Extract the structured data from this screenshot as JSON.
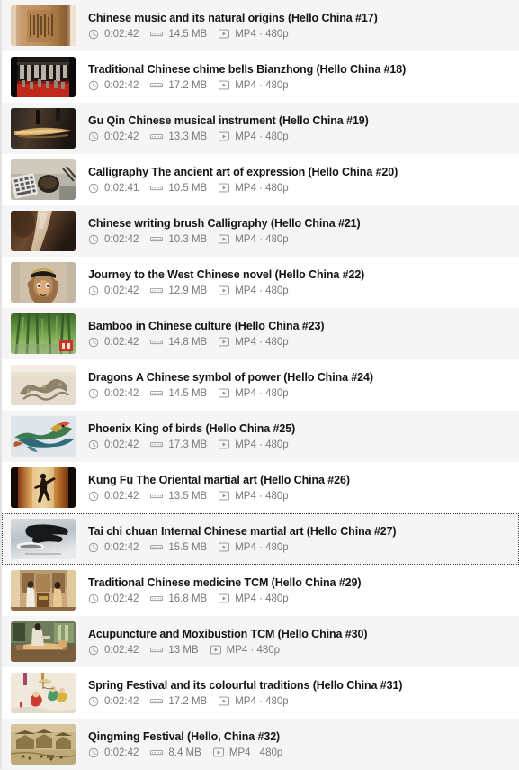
{
  "view": {
    "type": "media-file-list",
    "stripe_color": "#f5f5f5",
    "background_color": "#ffffff",
    "title_color": "#141414",
    "meta_color": "#79797c",
    "focus_outline_color": "#3a3a3a"
  },
  "icons": {
    "duration": "clock-icon",
    "filesize": "storage-icon",
    "format": "play-box-icon"
  },
  "items": [
    {
      "title": "Chinese music and its natural origins (Hello China #17)",
      "duration": "0:02:42",
      "size": "14.5 MB",
      "format": "MP4 · 480p",
      "thumb": "carved-wooden-plaque",
      "focused": false
    },
    {
      "title": "Traditional Chinese chime bells   Bianzhong (Hello China #18)",
      "duration": "0:02:42",
      "size": "17.2 MB",
      "format": "MP4 · 480p",
      "thumb": "chime-bells-red-stage",
      "focused": false
    },
    {
      "title": "Gu Qin   Chinese musical instrument (Hello China #19)",
      "duration": "0:02:42",
      "size": "13.3 MB",
      "format": "MP4 · 480p",
      "thumb": "guqin-zither-dark",
      "focused": false
    },
    {
      "title": "Calligraphy   The ancient art of expression (Hello China #20)",
      "duration": "0:02:41",
      "size": "10.5 MB",
      "format": "MP4 · 480p",
      "thumb": "calligraphy-desk-tools",
      "focused": false
    },
    {
      "title": "Chinese writing brush   Calligraphy (Hello China #21)",
      "duration": "0:02:42",
      "size": "10.3 MB",
      "format": "MP4 · 480p",
      "thumb": "writing-brush-closeup",
      "focused": false
    },
    {
      "title": "Journey to the West   Chinese novel (Hello China #22)",
      "duration": "0:02:42",
      "size": "12.9 MB",
      "format": "MP4 · 480p",
      "thumb": "monkey-king-character",
      "focused": false
    },
    {
      "title": "Bamboo in Chinese culture (Hello China #23)",
      "duration": "0:02:42",
      "size": "14.8 MB",
      "format": "MP4 · 480p",
      "thumb": "bamboo-forest-green",
      "focused": false
    },
    {
      "title": "Dragons   A Chinese symbol of power (Hello China #24)",
      "duration": "0:02:42",
      "size": "14.5 MB",
      "format": "MP4 · 480p",
      "thumb": "dragon-relief-stone",
      "focused": false
    },
    {
      "title": "Phoenix   King of birds (Hello China #25)",
      "duration": "0:02:42",
      "size": "17.3 MB",
      "format": "MP4 · 480p",
      "thumb": "phoenix-colorful-bird",
      "focused": false
    },
    {
      "title": "Kung Fu   The Oriental martial art (Hello China #26)",
      "duration": "0:02:42",
      "size": "13.5 MB",
      "format": "MP4 · 480p",
      "thumb": "kungfu-kick-silhouette",
      "focused": false
    },
    {
      "title": "Tai chi chuan   Internal Chinese martial art (Hello China #27)",
      "duration": "0:02:42",
      "size": "15.5 MB",
      "format": "MP4 · 480p",
      "thumb": "taichi-black-white",
      "focused": true
    },
    {
      "title": "Traditional Chinese medicine   TCM (Hello China #29)",
      "duration": "0:02:42",
      "size": "16.8 MB",
      "format": "MP4 · 480p",
      "thumb": "tcm-consultation-room",
      "focused": false
    },
    {
      "title": "Acupuncture and Moxibustion   TCM (Hello China #30)",
      "duration": "0:02:42",
      "size": "13 MB",
      "format": "MP4 · 480p",
      "thumb": "acupuncture-treatment",
      "focused": false
    },
    {
      "title": "Spring Festival and its colourful traditions (Hello China #31)",
      "duration": "0:02:42",
      "size": "17.2 MB",
      "format": "MP4 · 480p",
      "thumb": "spring-festival-painting",
      "focused": false
    },
    {
      "title": "Qingming Festival (Hello, China #32)",
      "duration": "0:02:42",
      "size": "8.4 MB",
      "format": "MP4 · 480p",
      "thumb": "qingming-scroll-painting",
      "focused": false
    }
  ]
}
